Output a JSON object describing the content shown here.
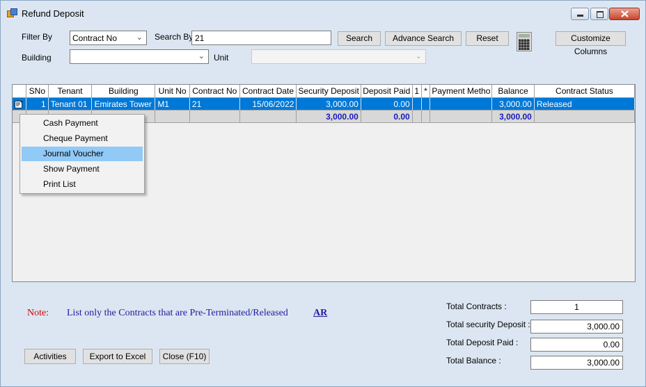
{
  "window": {
    "title": "Refund Deposit"
  },
  "filter": {
    "filter_by_label": "Filter By",
    "filter_by_value": "Contract No",
    "search_by_label": "Search By",
    "search_value": "21",
    "building_label": "Building",
    "building_value": "",
    "unit_label": "Unit",
    "unit_value": ""
  },
  "buttons": {
    "search": "Search",
    "advance_search": "Advance Search",
    "reset": "Reset",
    "customize_columns": "Customize Columns",
    "activities": "Activities",
    "export_excel": "Export to Excel",
    "close": "Close (F10)"
  },
  "grid": {
    "columns": [
      "SNo",
      "Tenant",
      "Building",
      "Unit No",
      "Contract No",
      "Contract Date",
      "Security Deposit",
      "Deposit Paid",
      "1",
      "*",
      "Payment Metho",
      "Balance",
      "Contract Status"
    ],
    "rows": [
      {
        "sno": "1",
        "tenant": "Tenant 01",
        "building": "Emirates Tower",
        "unit_no": "M1",
        "contract_no": "21",
        "contract_date": "15/06/2022",
        "security_deposit": "3,000.00",
        "deposit_paid": "0.00",
        "c1": "",
        "star": "",
        "payment_method": "",
        "balance": "3,000.00",
        "status": "Released"
      }
    ],
    "totals": {
      "security_deposit": "3,000.00",
      "deposit_paid": "0.00",
      "balance": "3,000.00"
    }
  },
  "context_menu": {
    "items": [
      "Cash Payment",
      "Cheque Payment",
      "Journal Voucher",
      "Show Payment",
      "Print List"
    ],
    "highlighted": "Journal Voucher"
  },
  "note": {
    "label": "Note:",
    "text": "List only the Contracts that are Pre-Terminated/Released",
    "link": "AR"
  },
  "summary": {
    "total_contracts_label": "Total Contracts :",
    "total_contracts_value": "1",
    "total_security_label": "Total security Deposit :",
    "total_security_value": "3,000.00",
    "total_paid_label": "Total Deposit Paid :",
    "total_paid_value": "0.00",
    "total_balance_label": "Total Balance :",
    "total_balance_value": "3,000.00"
  },
  "colors": {
    "selection": "#0078d7",
    "menu_highlight": "#91c9f7",
    "note_red": "#d40000",
    "note_blue": "#1c1c9c",
    "total_blue": "#1a1ab8"
  }
}
